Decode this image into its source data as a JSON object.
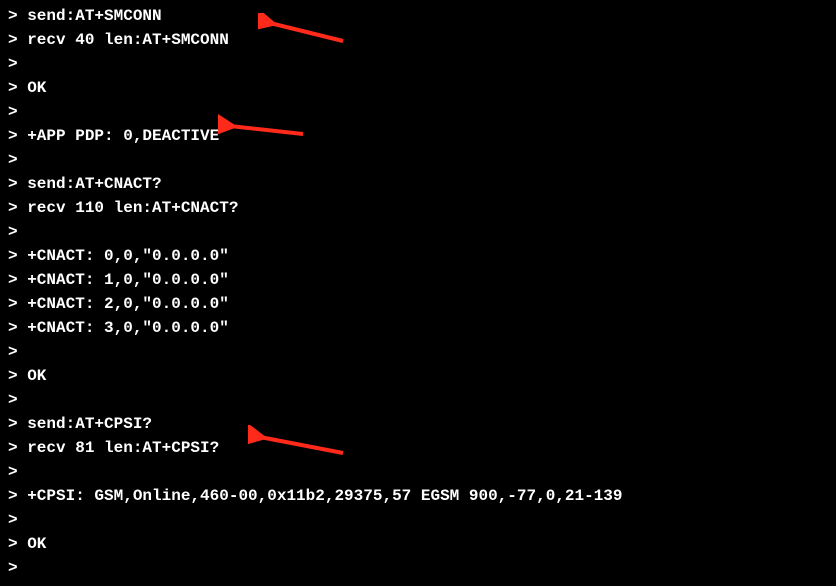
{
  "terminal": {
    "lines": [
      "> send:AT+SMCONN",
      "> recv 40 len:AT+SMCONN",
      "> ",
      "> OK",
      "> ",
      "> +APP PDP: 0,DEACTIVE",
      "> ",
      "> send:AT+CNACT?",
      "> recv 110 len:AT+CNACT?",
      "> ",
      "> +CNACT: 0,0,\"0.0.0.0\"",
      "> +CNACT: 1,0,\"0.0.0.0\"",
      "> +CNACT: 2,0,\"0.0.0.0\"",
      "> +CNACT: 3,0,\"0.0.0.0\"",
      "> ",
      "> OK",
      "> ",
      "> send:AT+CPSI?",
      "> recv 81 len:AT+CPSI?",
      "> ",
      "> +CPSI: GSM,Online,460-00,0x11b2,29375,57 EGSM 900,-77,0,21-139",
      "> ",
      "> OK",
      "> "
    ]
  },
  "annotations": {
    "arrow_color": "#ff2a1a"
  }
}
